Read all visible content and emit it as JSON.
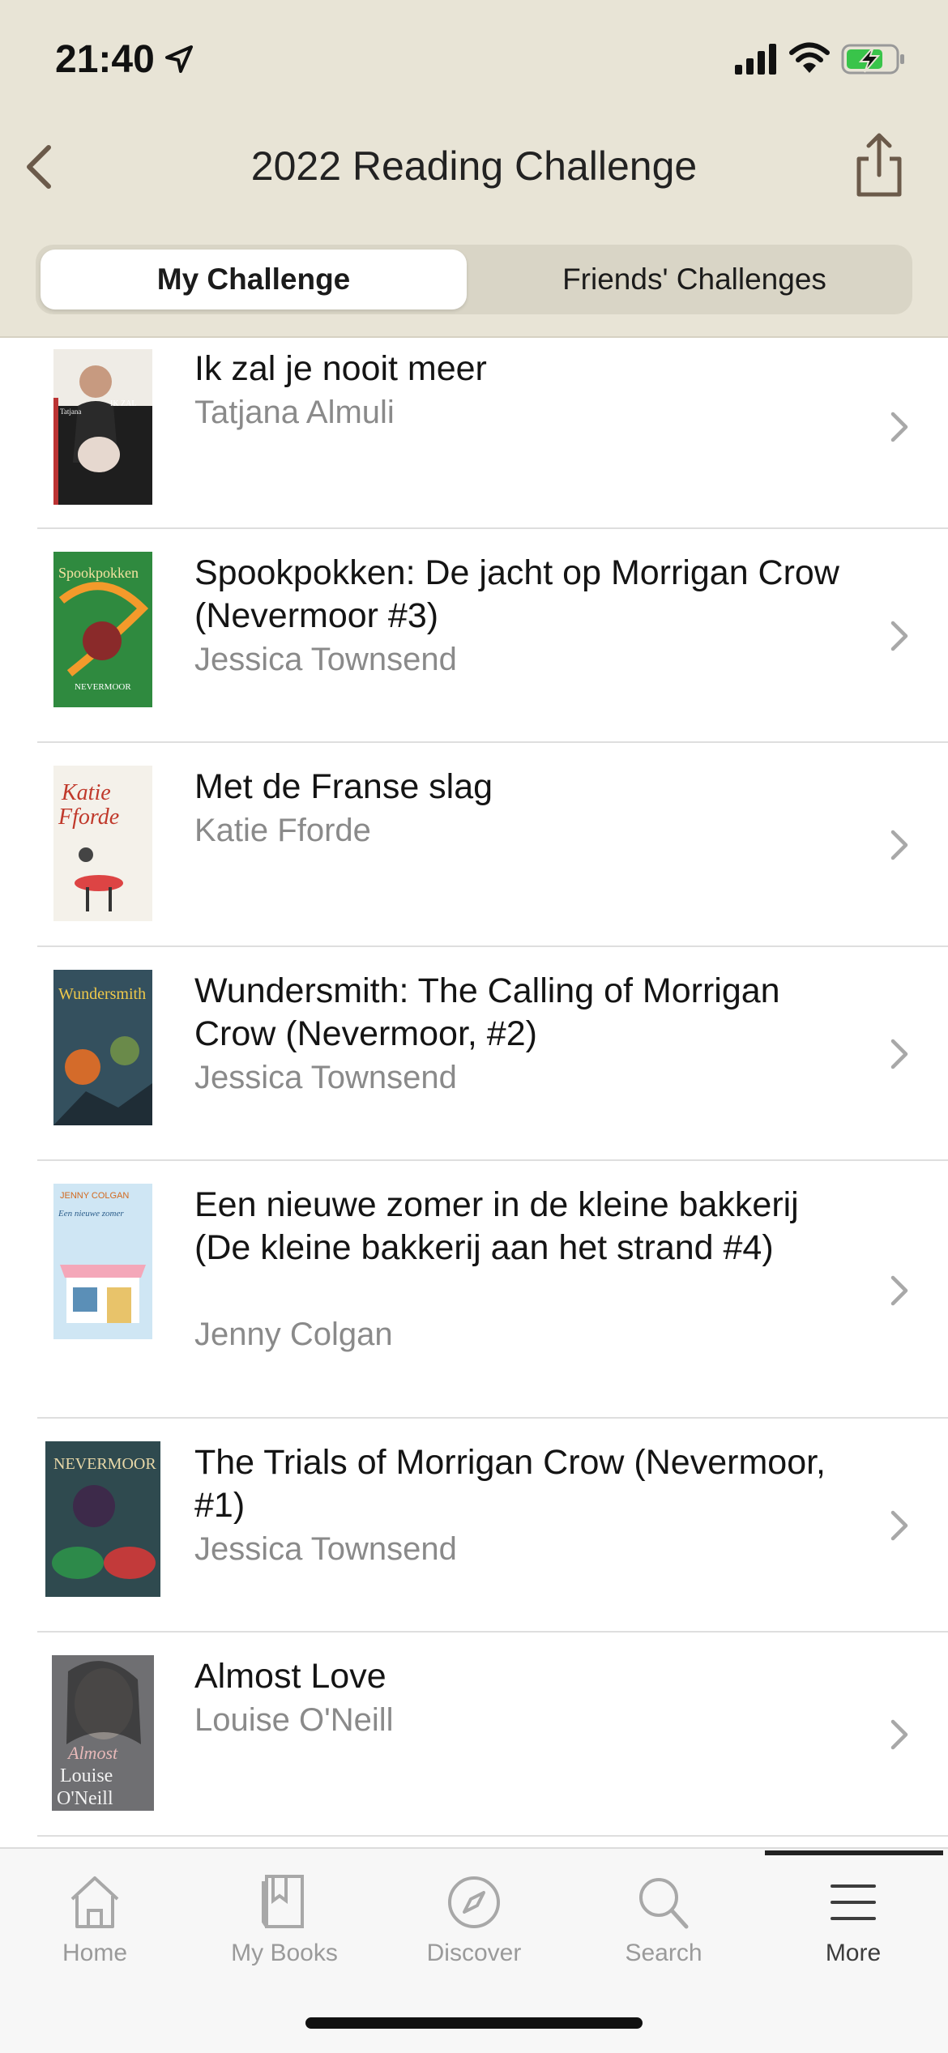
{
  "status_bar": {
    "time": "21:40",
    "location_icon": "location-arrow-icon",
    "signal_icon": "cellular-signal-icon",
    "wifi_icon": "wifi-icon",
    "battery_icon": "battery-charging-icon"
  },
  "nav": {
    "title": "2022 Reading Challenge",
    "back_icon": "chevron-left-icon",
    "share_icon": "share-icon"
  },
  "segments": {
    "my_challenge": "My Challenge",
    "friends_challenges": "Friends' Challenges",
    "selected": "My Challenge"
  },
  "books": [
    {
      "title": "Ik zal je nooit meer",
      "author": "Tatjana Almuli",
      "cover_color": "#2a2a2a"
    },
    {
      "title": "Spookpokken: De jacht op Morrigan Crow (Nevermoor #3)",
      "author": "Jessica Townsend",
      "cover_color": "#2f8a3f"
    },
    {
      "title": "Met de Franse slag",
      "author": "Katie Fforde",
      "cover_color": "#f2efe8"
    },
    {
      "title": "Wundersmith: The Calling of Morrigan Crow (Nevermoor, #2)",
      "author": "Jessica Townsend",
      "cover_color": "#3a5160"
    },
    {
      "title": "Een nieuwe zomer in de kleine bakkerij (De kleine bakkerij aan het strand #4)",
      "author": "Jenny Colgan",
      "cover_color": "#bcd9ee"
    },
    {
      "title": "The Trials of Morrigan Crow (Nevermoor, #1)",
      "author": "Jessica Townsend",
      "cover_color": "#314a4f"
    },
    {
      "title": "Almost Love",
      "author": "Louise O'Neill",
      "cover_color": "#6f6f72"
    }
  ],
  "tabs": [
    {
      "label": "Home",
      "icon": "home-icon"
    },
    {
      "label": "My Books",
      "icon": "book-icon"
    },
    {
      "label": "Discover",
      "icon": "compass-icon"
    },
    {
      "label": "Search",
      "icon": "search-icon"
    },
    {
      "label": "More",
      "icon": "menu-icon"
    }
  ],
  "selected_tab": "More"
}
